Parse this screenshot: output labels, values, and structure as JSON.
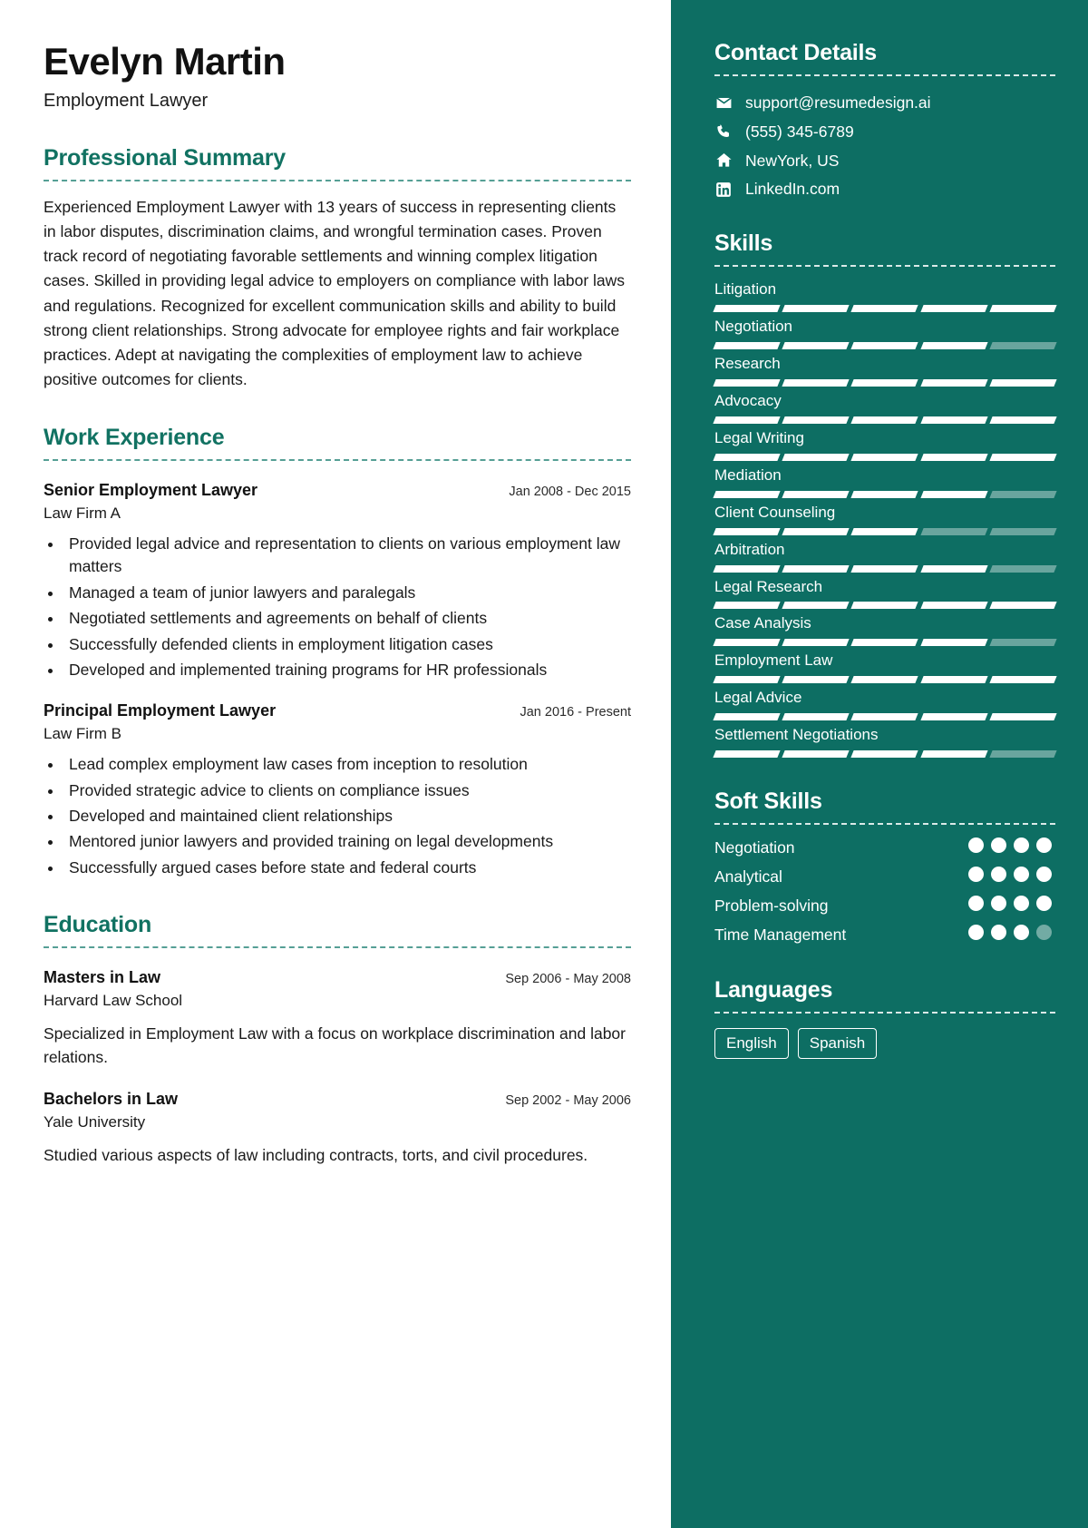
{
  "header": {
    "name": "Evelyn Martin",
    "role": "Employment Lawyer"
  },
  "theme": {
    "accent": "#117262",
    "sidebar_bg": "#0d6e63",
    "text": "#1a1a1a"
  },
  "summary": {
    "title": "Professional Summary",
    "text": "Experienced Employment Lawyer with 13 years of success in representing clients in labor disputes, discrimination claims, and wrongful termination cases. Proven track record of negotiating favorable settlements and winning complex litigation cases. Skilled in providing legal advice to employers on compliance with labor laws and regulations. Recognized for excellent communication skills and ability to build strong client relationships. Strong advocate for employee rights and fair workplace practices. Adept at navigating the complexities of employment law to achieve positive outcomes for clients."
  },
  "work": {
    "title": "Work Experience",
    "entries": [
      {
        "title": "Senior Employment Lawyer",
        "org": "Law Firm A",
        "date": "Jan 2008 - Dec 2015",
        "bullets": [
          "Provided legal advice and representation to clients on various employment law matters",
          "Managed a team of junior lawyers and paralegals",
          "Negotiated settlements and agreements on behalf of clients",
          "Successfully defended clients in employment litigation cases",
          "Developed and implemented training programs for HR professionals"
        ]
      },
      {
        "title": "Principal Employment Lawyer",
        "org": "Law Firm B",
        "date": "Jan 2016 - Present",
        "bullets": [
          "Lead complex employment law cases from inception to resolution",
          "Provided strategic advice to clients on compliance issues",
          "Developed and maintained client relationships",
          "Mentored junior lawyers and provided training on legal developments",
          "Successfully argued cases before state and federal courts"
        ]
      }
    ]
  },
  "education": {
    "title": "Education",
    "entries": [
      {
        "title": "Masters in Law",
        "org": "Harvard Law School",
        "date": "Sep 2006 - May 2008",
        "desc": "Specialized in Employment Law with a focus on workplace discrimination and labor relations."
      },
      {
        "title": "Bachelors in Law",
        "org": "Yale University",
        "date": "Sep 2002 - May 2006",
        "desc": "Studied various aspects of law including contracts, torts, and civil procedures."
      }
    ]
  },
  "contact": {
    "title": "Contact Details",
    "items": [
      {
        "icon": "envelope-icon",
        "value": "support@resumedesign.ai"
      },
      {
        "icon": "phone-icon",
        "value": "(555) 345-6789"
      },
      {
        "icon": "home-icon",
        "value": "NewYork, US"
      },
      {
        "icon": "linkedin-icon",
        "value": "LinkedIn.com"
      }
    ]
  },
  "skills": {
    "title": "Skills",
    "max": 5,
    "items": [
      {
        "name": "Litigation",
        "level": 5
      },
      {
        "name": "Negotiation",
        "level": 4
      },
      {
        "name": "Research",
        "level": 5
      },
      {
        "name": "Advocacy",
        "level": 5
      },
      {
        "name": "Legal Writing",
        "level": 5
      },
      {
        "name": "Mediation",
        "level": 4
      },
      {
        "name": "Client Counseling",
        "level": 3
      },
      {
        "name": "Arbitration",
        "level": 4
      },
      {
        "name": "Legal Research",
        "level": 5
      },
      {
        "name": "Case Analysis",
        "level": 4
      },
      {
        "name": "Employment Law",
        "level": 5
      },
      {
        "name": "Legal Advice",
        "level": 5
      },
      {
        "name": "Settlement Negotiations",
        "level": 4
      }
    ]
  },
  "soft_skills": {
    "title": "Soft Skills",
    "max": 4,
    "items": [
      {
        "name": "Negotiation",
        "level": 4
      },
      {
        "name": "Analytical",
        "level": 4
      },
      {
        "name": "Problem-solving",
        "level": 4
      },
      {
        "name": "Time Management",
        "level": 3
      }
    ]
  },
  "languages": {
    "title": "Languages",
    "items": [
      "English",
      "Spanish"
    ]
  }
}
